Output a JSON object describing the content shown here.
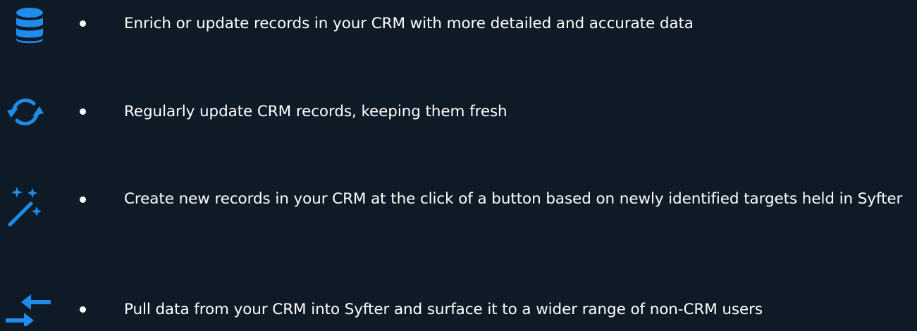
{
  "theme": {
    "background": "#0e1a26",
    "accent": "#1e8cea",
    "text": "#ffffff"
  },
  "features": [
    {
      "icon": "database-icon",
      "text": "Enrich or update records in your CRM with more detailed and accurate data"
    },
    {
      "icon": "sync-icon",
      "text": "Regularly update CRM records, keeping them fresh"
    },
    {
      "icon": "magic-wand-icon",
      "text": "Create new records in your CRM at the click of a button based on newly identified targets held in Syfter"
    },
    {
      "icon": "arrows-exchange-icon",
      "text": "Pull data from your CRM into Syfter and surface it to a wider range of non-CRM users"
    }
  ]
}
